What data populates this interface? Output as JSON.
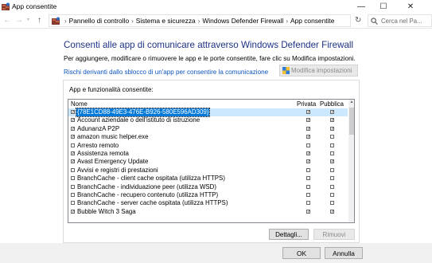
{
  "window": {
    "title": "App consentite",
    "app_icon": "firewall-app-icon",
    "minimize_glyph": "—",
    "maximize_glyph": "☐",
    "close_glyph": "✕"
  },
  "nav": {
    "back_glyph": "←",
    "forward_glyph": "→",
    "dropdown_glyph": "▾",
    "up_glyph": "↑",
    "separator": "›",
    "breadcrumbs": [
      "Pannello di controllo",
      "Sistema e sicurezza",
      "Windows Defender Firewall",
      "App consentite"
    ],
    "refresh_glyph": "↻",
    "search_placeholder": "Cerca nel Pa..."
  },
  "main": {
    "heading": "Consenti alle app di comunicare attraverso Windows Defender Firewall",
    "description": "Per aggiungere, modificare o rimuovere le app e le porte consentite, fare clic su Modifica impostazioni.",
    "risk_link": "Rischi derivanti dallo sblocco di un'app per consentire la comunicazione",
    "change_settings_label": "Modifica impostazioni",
    "group_label": "App e funzionalità consentite:",
    "columns": {
      "name": "Nome",
      "private": "Privata",
      "public": "Pubblica"
    },
    "apps": [
      {
        "name": "{78E1CD88-49E3-476E-B926-580E596AD309}",
        "enabled": true,
        "private": true,
        "public": true,
        "selected": true
      },
      {
        "name": "Account aziendale o dell'istituto di istruzione",
        "enabled": true,
        "private": true,
        "public": true
      },
      {
        "name": "AdunanzA P2P",
        "enabled": true,
        "private": true,
        "public": true
      },
      {
        "name": "amazon music helper.exe",
        "enabled": true,
        "private": true,
        "public": false
      },
      {
        "name": "Arresto remoto",
        "enabled": false,
        "private": false,
        "public": false
      },
      {
        "name": "Assistenza remota",
        "enabled": true,
        "private": true,
        "public": false
      },
      {
        "name": "Avast Emergency Update",
        "enabled": true,
        "private": true,
        "public": true
      },
      {
        "name": "Avvisi e registri di prestazioni",
        "enabled": false,
        "private": false,
        "public": false
      },
      {
        "name": "BranchCache - client cache ospitata (utilizza HTTPS)",
        "enabled": false,
        "private": false,
        "public": false
      },
      {
        "name": "BranchCache - individuazione peer (utilizza WSD)",
        "enabled": false,
        "private": false,
        "public": false
      },
      {
        "name": "BranchCache - recupero contenuto (utilizza HTTP)",
        "enabled": false,
        "private": false,
        "public": false
      },
      {
        "name": "BranchCache - server cache ospitata (utilizza HTTPS)",
        "enabled": false,
        "private": false,
        "public": false
      },
      {
        "name": "Bubble Witch 3 Saga",
        "enabled": true,
        "private": true,
        "public": true
      }
    ],
    "details_label": "Dettagli...",
    "remove_label": "Rimuovi"
  },
  "footer": {
    "ok_label": "OK",
    "cancel_label": "Annulla"
  },
  "check_glyph": "✓",
  "colors": {
    "heading": "#1e3287",
    "link": "#0a53be",
    "selection": "#0078d7"
  }
}
